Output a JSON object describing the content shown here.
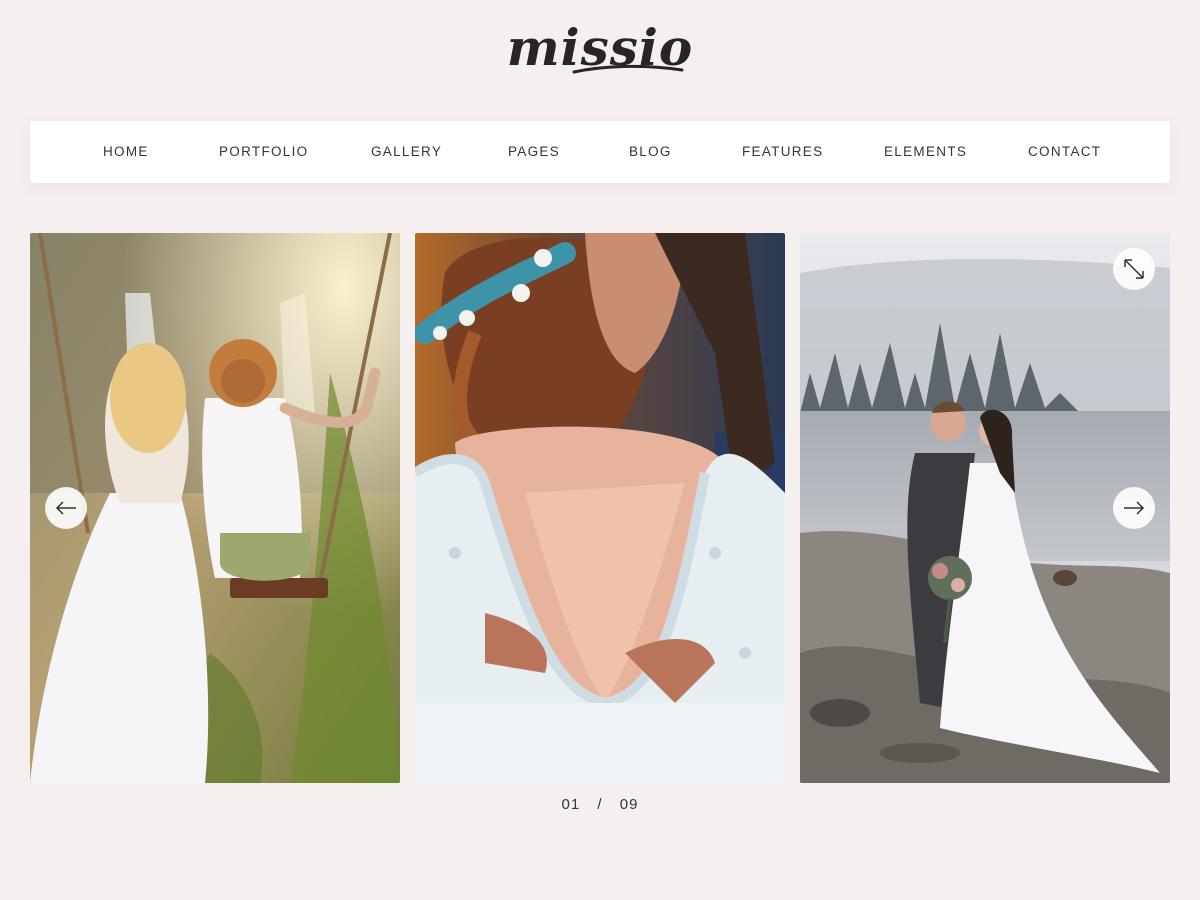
{
  "brand": {
    "name": "missio"
  },
  "nav": {
    "items": [
      {
        "label": "HOME"
      },
      {
        "label": "PORTFOLIO"
      },
      {
        "label": "GALLERY"
      },
      {
        "label": "PAGES"
      },
      {
        "label": "BLOG"
      },
      {
        "label": "FEATURES"
      },
      {
        "label": "ELEMENTS"
      },
      {
        "label": "CONTACT"
      }
    ]
  },
  "slider": {
    "current": "01",
    "separator": "/",
    "total": "09",
    "slides": [
      {
        "subject": "couple-on-swing-by-waterfall"
      },
      {
        "subject": "bride-lace-dress-embrace"
      },
      {
        "subject": "couple-kissing-by-misty-lake"
      }
    ],
    "controls": {
      "prev_icon": "arrow-left-icon",
      "next_icon": "arrow-right-icon",
      "expand_icon": "expand-icon"
    }
  },
  "colors": {
    "background": "#f5efef",
    "nav_background": "#ffffff",
    "text": "#3a3333",
    "logo": "#2a2424"
  }
}
